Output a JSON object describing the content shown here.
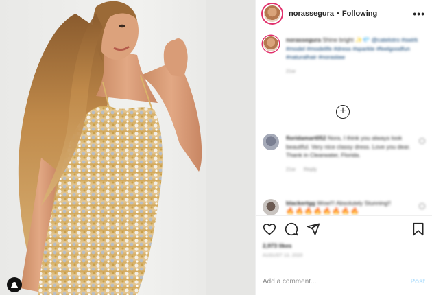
{
  "header": {
    "username": "norassegura",
    "separator": "•",
    "follow_state": "Following",
    "more_label": "•••"
  },
  "caption": {
    "username": "norassegura",
    "text": "Shine bright",
    "emoji": "✨💎",
    "hashtags": "@catelotro #swirk #model #modelife #dress #sparkle #feelgoodfun #naturalhair #noraslaw",
    "time": "21w"
  },
  "load_more_label": "+",
  "comments": [
    {
      "username": "floridamart052",
      "text": "Nora, I think you always look beautiful. Very nice classy dress. Love you dear. Thank in Clearwater, Florida.",
      "time": "21w",
      "reply_label": "Reply"
    },
    {
      "username": "blackertgg",
      "text": "Wow!!! Absolutely Stunning!!",
      "emojis": "🔥🔥🔥🔥🔥🔥🔥🔥"
    }
  ],
  "likes": "2,973 likes",
  "date": "AUGUST 13, 2020",
  "add_comment": {
    "placeholder": "Add a comment...",
    "post_label": "Post"
  },
  "colors": {
    "link": "#00376b",
    "secondary": "#8e8e8e",
    "post_disabled": "#b2dffc",
    "story_ring": "#e1306c"
  },
  "icons": [
    "heart-icon",
    "comment-icon",
    "share-icon",
    "bookmark-icon",
    "user-tag-icon",
    "more-options-icon",
    "load-more-icon"
  ]
}
